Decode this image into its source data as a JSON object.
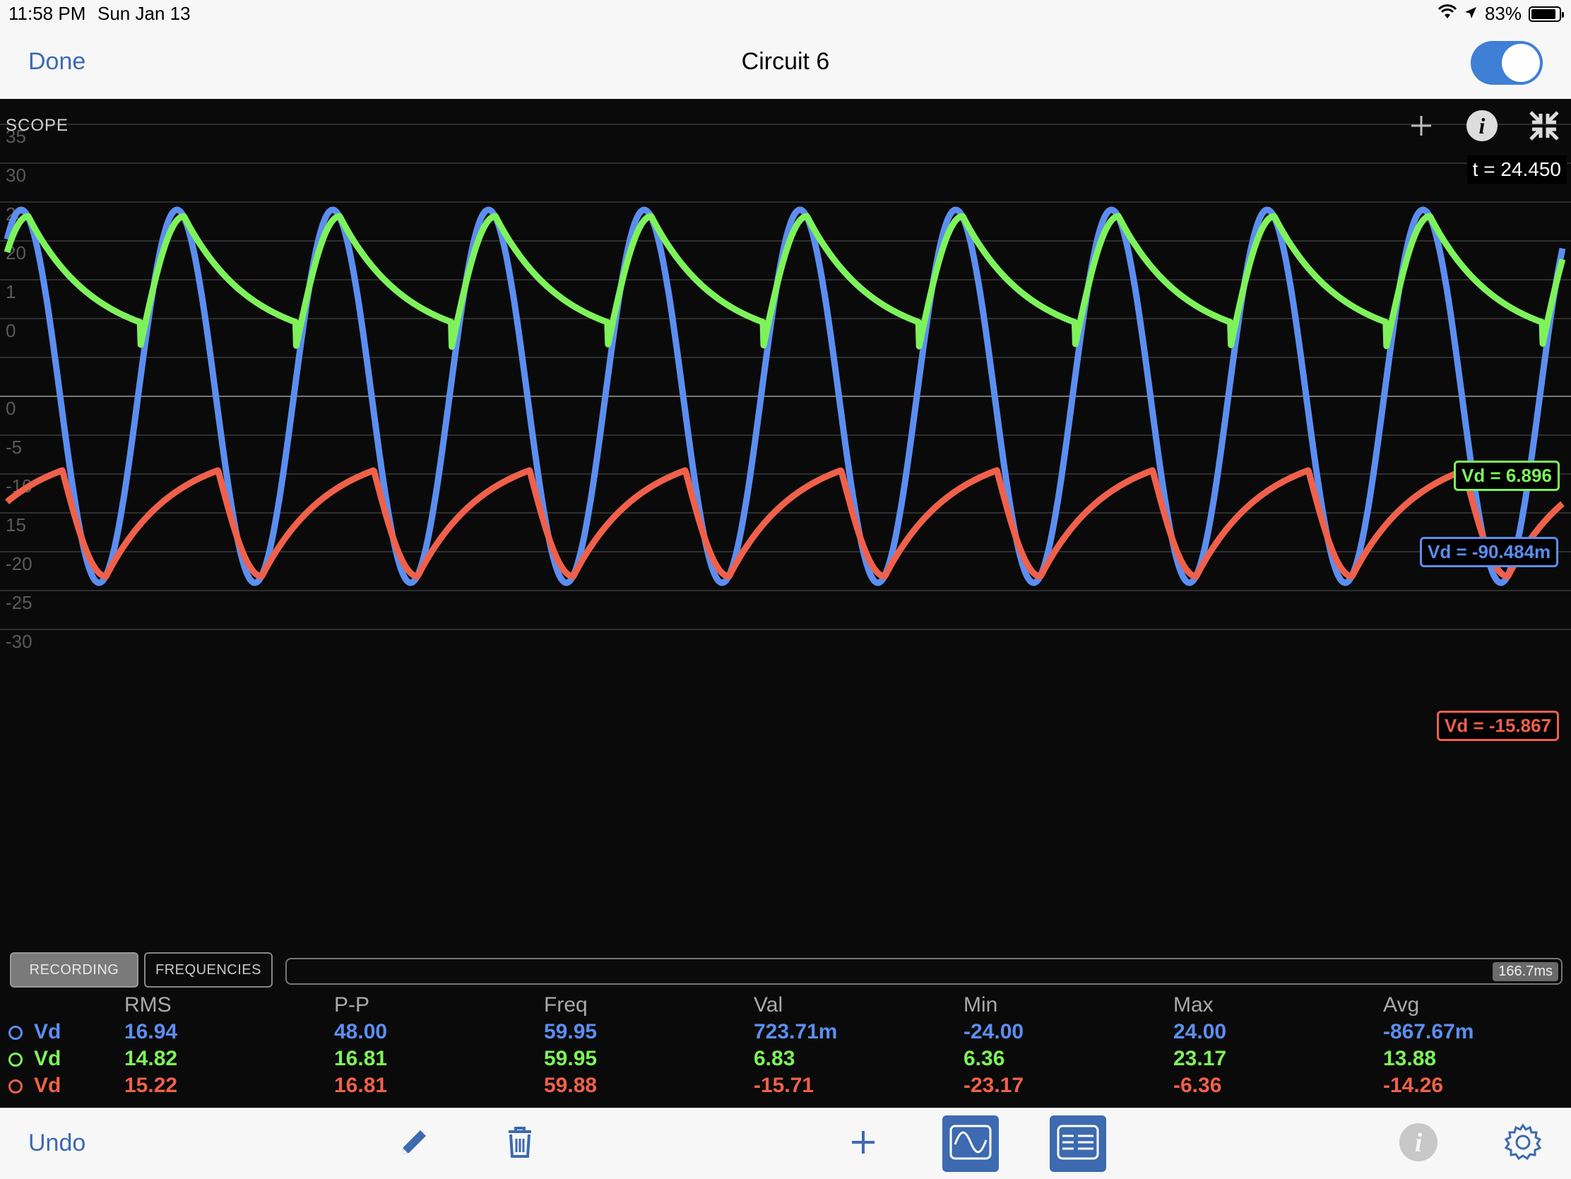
{
  "status_bar": {
    "time": "11:58 PM",
    "date": "Sun Jan 13",
    "battery": "83%",
    "battery_level": 0.83,
    "icons": [
      "wifi-icon",
      "location-icon",
      "battery-icon"
    ]
  },
  "nav": {
    "done_label": "Done",
    "title": "Circuit 6",
    "toggle_on": true
  },
  "scope": {
    "label": "SCOPE",
    "time_readout": "t = 24.450",
    "icons": [
      "plus-icon",
      "info-icon",
      "collapse-icon"
    ],
    "cursor_labels": [
      {
        "text": "Vd = 6.896",
        "color": "#7ef25b"
      },
      {
        "text": "Vd = -90.484m",
        "color": "#5b8ef0"
      },
      {
        "text": "Vd = -15.867",
        "color": "#f0604a"
      }
    ]
  },
  "chart_data": {
    "type": "line",
    "title": "",
    "xlabel": "",
    "ylabel": "",
    "ylim": [
      -35,
      38
    ],
    "y_ticks": [
      35,
      30,
      25,
      20,
      15,
      10,
      5,
      0,
      -5,
      -10,
      -15,
      -20,
      -25,
      -30
    ],
    "y_tick_labels": [
      "35",
      "30",
      "25",
      "20",
      "1",
      "0",
      "",
      "0",
      "-5",
      "-10",
      "15",
      "-20",
      "-25",
      "-30"
    ],
    "grid": true,
    "frequency_hz": 59.95,
    "cycles_visible": 10,
    "series": [
      {
        "color": "#5b8ef0",
        "shape": "sine",
        "amplitude": 24.0,
        "offset": 0.0
      },
      {
        "color": "#7ef25b",
        "shape": "rectified-decay",
        "max": 23.17,
        "min": 6.36
      },
      {
        "color": "#f0604a",
        "shape": "rectified-decay-negative",
        "max": -6.36,
        "min": -23.17
      }
    ]
  },
  "controls": {
    "recording_label": "RECORDING",
    "frequencies_label": "FREQUENCIES",
    "timeline_label": "166.7ms"
  },
  "stats": {
    "headers": [
      "RMS",
      "P-P",
      "Freq",
      "Val",
      "Min",
      "Max",
      "Avg"
    ],
    "rows": [
      {
        "name": "Vd",
        "color": "#5b8ef0",
        "values": [
          "16.94",
          "48.00",
          "59.95",
          "723.71m",
          "-24.00",
          "24.00",
          "-867.67m"
        ]
      },
      {
        "name": "Vd",
        "color": "#7ef25b",
        "values": [
          "14.82",
          "16.81",
          "59.95",
          "6.83",
          "6.36",
          "23.17",
          "13.88"
        ]
      },
      {
        "name": "Vd",
        "color": "#f0604a",
        "values": [
          "15.22",
          "16.81",
          "59.88",
          "-15.71",
          "-23.17",
          "-6.36",
          "-14.26"
        ]
      }
    ]
  },
  "toolbar": {
    "undo_label": "Undo",
    "icons": [
      "pencil-icon",
      "trash-icon",
      "plus-icon",
      "scope-icon",
      "table-icon",
      "info-icon",
      "gear-icon"
    ]
  }
}
